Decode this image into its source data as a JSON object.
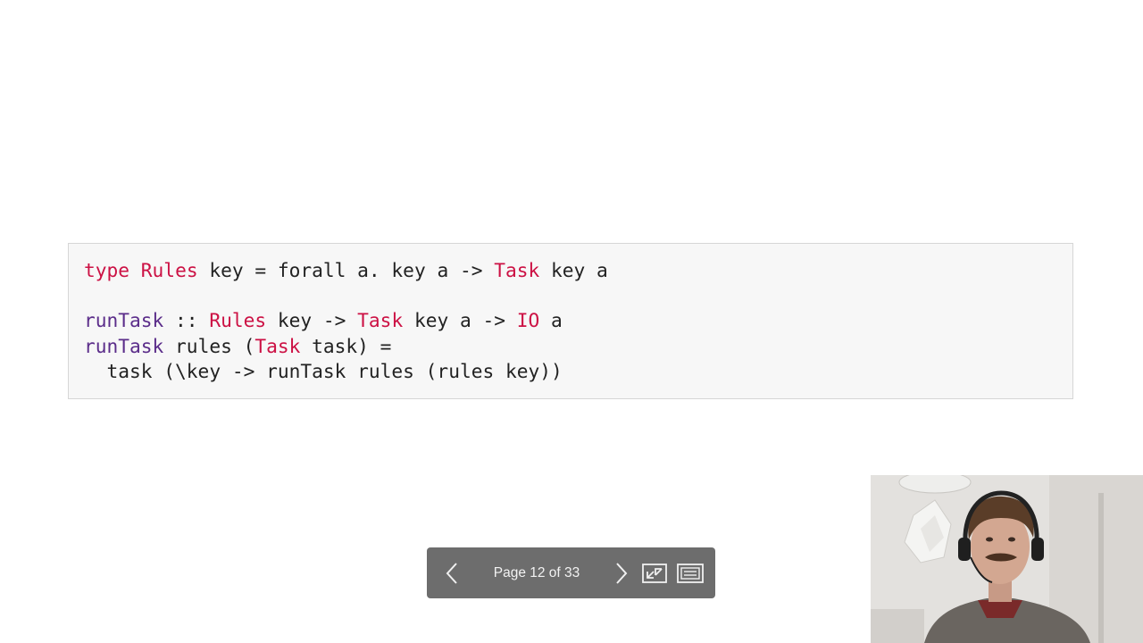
{
  "slide": {
    "code_lines": [
      [
        {
          "t": "type",
          "c": "kw"
        },
        {
          "t": " ",
          "c": "pl"
        },
        {
          "t": "Rules",
          "c": "ty"
        },
        {
          "t": " key = forall a. key a -> ",
          "c": "pl"
        },
        {
          "t": "Task",
          "c": "ty"
        },
        {
          "t": " key a",
          "c": "pl"
        }
      ],
      [],
      [
        {
          "t": "runTask",
          "c": "fn"
        },
        {
          "t": " :: ",
          "c": "pl"
        },
        {
          "t": "Rules",
          "c": "ty"
        },
        {
          "t": " key -> ",
          "c": "pl"
        },
        {
          "t": "Task",
          "c": "ty"
        },
        {
          "t": " key a -> ",
          "c": "pl"
        },
        {
          "t": "IO",
          "c": "ty"
        },
        {
          "t": " a",
          "c": "pl"
        }
      ],
      [
        {
          "t": "runTask",
          "c": "fn"
        },
        {
          "t": " rules (",
          "c": "pl"
        },
        {
          "t": "Task",
          "c": "ty"
        },
        {
          "t": " task) =",
          "c": "pl"
        }
      ],
      [
        {
          "t": "  task (\\key -> runTask rules (rules key))",
          "c": "pl"
        }
      ]
    ]
  },
  "pager": {
    "label": "Page 12 of 33",
    "current_page": 12,
    "total_pages": 33,
    "icons": {
      "prev": "chevron-left-icon",
      "next": "chevron-right-icon",
      "exit_fullscreen": "exit-fullscreen-icon",
      "sidebar": "sidebar-toggle-icon"
    }
  },
  "colors": {
    "keyword": "#cc1144",
    "function": "#5b2d8a",
    "text": "#222222",
    "code_bg": "#f7f7f7",
    "pager_bg": "#6d6d6d"
  }
}
